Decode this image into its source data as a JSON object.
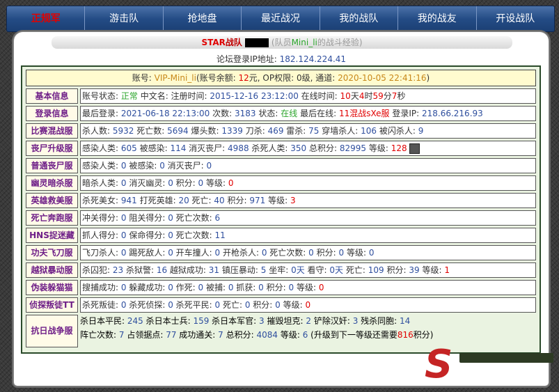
{
  "nav": {
    "items": [
      "正规军",
      "游击队",
      "抢地盘",
      "最近战况",
      "我的战队",
      "我的战友",
      "开设战队"
    ]
  },
  "header": {
    "star_word": "STAR",
    "team_word": "战队",
    "paren_before": "(队员",
    "player": "Mini_li",
    "paren_after": "的战斗经验)"
  },
  "ip": {
    "label": "论坛登录IP地址:",
    "value": "182.124.224.41"
  },
  "account": {
    "p1": "账号: ",
    "name": "VIP-Mini_li",
    "p2": "(账号余额: ",
    "balance": "12",
    "p3": "元, OP权限: 0级, 通道: ",
    "time": "2020-10-05 22:41:16",
    "p4": ")"
  },
  "rows": [
    {
      "label": "基本信息",
      "t": [
        "账号状态: ",
        "正常",
        " 中文名: 注册时间: ",
        "2015-12-16 23:12:00",
        " 在线时间: ",
        "10",
        "天",
        "4",
        "时",
        "59",
        "分",
        "7",
        "秒"
      ]
    },
    {
      "label": "登录信息",
      "t": [
        "最后登录: ",
        "2021-06-18 22:13:00",
        " 次数: ",
        "3183",
        " 状态: ",
        "在线",
        " 最后在线: ",
        "11混战sXe服",
        " 登录IP: ",
        "218.66.216.93"
      ]
    },
    {
      "label": "比赛混战服",
      "t": [
        "杀人数: ",
        "5932",
        " 死亡数: ",
        "5694",
        " 爆头数: ",
        "1339",
        " 刀杀: ",
        "469",
        " 雷杀: ",
        "75",
        " 穿墙杀人: ",
        "106",
        " 被闪杀人: ",
        "9"
      ]
    },
    {
      "label": "丧尸升级服",
      "t": [
        "感染人类: ",
        "605",
        " 被感染: ",
        "114",
        " 消灭丧尸: ",
        "4988",
        " 杀死人类: ",
        "350",
        " 总积分: ",
        "82995",
        " 等级: ",
        "128"
      ]
    },
    {
      "label": "普通丧尸服",
      "t": [
        "感染人类: ",
        "0",
        " 被感染: ",
        "0",
        " 消灭丧尸: ",
        "0"
      ]
    },
    {
      "label": "幽灵暗杀服",
      "t": [
        "暗杀人类: ",
        "0",
        " 消灭幽灵: ",
        "0",
        " 积分: ",
        "0",
        " 等级: ",
        "0"
      ]
    },
    {
      "label": "英雄救美服",
      "t": [
        "杀死美女: ",
        "941",
        " 打死英雄: ",
        "20",
        " 死亡: ",
        "40",
        " 积分: ",
        "971",
        " 等级: ",
        "3"
      ]
    },
    {
      "label": "死亡奔跑服",
      "t": [
        "冲关得分: ",
        "0",
        " 阻关得分: ",
        "0",
        " 死亡次数: ",
        "6"
      ]
    },
    {
      "label": "HNS捉迷藏",
      "t": [
        "抓人得分: ",
        "0",
        " 保命得分: ",
        "0",
        " 死亡次数: ",
        "11"
      ]
    },
    {
      "label": "功夫飞刀服",
      "t": [
        "飞刀杀人: ",
        "0",
        " 踢死敌人: ",
        "0",
        " 开车撞人: ",
        "0",
        " 开枪杀人: ",
        "0",
        " 死亡次数: ",
        "0",
        " 积分: ",
        "0",
        " 等级: ",
        "0"
      ]
    },
    {
      "label": "越狱暴动服",
      "t": [
        "杀囚犯: ",
        "23",
        " 杀狱警: ",
        "16",
        " 越狱成功: ",
        "31",
        " 镇压暴动: ",
        "5",
        " 坐牢: ",
        "0天",
        " 看守: ",
        "0天",
        " 死亡: ",
        "109",
        " 积分: ",
        "39",
        " 等级: ",
        "1"
      ]
    },
    {
      "label": "伪装躲猫猫",
      "t": [
        "搜捕成功: ",
        "0",
        " 躲藏成功: ",
        "0",
        " 作死: ",
        "0",
        " 被捕: ",
        "0",
        " 抓获: ",
        "0",
        " 积分: ",
        "0",
        " 等级: ",
        "0"
      ]
    },
    {
      "label": "侦探叛徒TT",
      "t": [
        "杀死叛徒: ",
        "0",
        " 杀死侦探: ",
        "0",
        " 杀死平民: ",
        "0",
        " 死亡: ",
        "0",
        " 积分: ",
        "0",
        " 等级: ",
        "0"
      ]
    }
  ],
  "war": {
    "label": "抗日战争服",
    "line1": [
      "杀日本平民: ",
      "245",
      " 杀日本士兵: ",
      "159",
      " 杀日本军官: ",
      "3",
      " 摧毁坦克: ",
      "2",
      " 铲除汉奸: ",
      "3",
      " 残杀同胞: ",
      "14"
    ],
    "line2": [
      "阵亡次数: ",
      "7",
      " 占领据点: ",
      "77",
      " 成功通关: ",
      "7",
      " 总积分: ",
      "4084",
      " 等级: ",
      "6",
      " (升级到下一等级还需要",
      "816",
      "积分)"
    ]
  },
  "colors": {
    "nav_bg": "#244c86",
    "label_text": "#6e1e87",
    "number": "#2f4f9e",
    "red": "#e00000",
    "green": "#2ba52b"
  },
  "icons": {
    "avatar": "player-avatar-icon",
    "watermark": "site-logo-watermark"
  }
}
